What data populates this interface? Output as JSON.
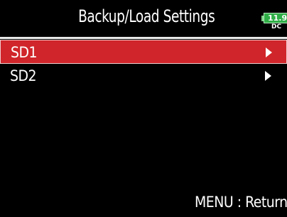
{
  "header": {
    "title": "Backup/Load Settings",
    "battery": {
      "voltage": "11.9",
      "power_source": "DC",
      "color": "#2fae47"
    }
  },
  "menu": {
    "selected_index": 0,
    "selected_color": "#d0252a",
    "items": [
      {
        "label": "SD1",
        "icon": "chevron-right-icon"
      },
      {
        "label": "SD2",
        "icon": "chevron-right-icon"
      }
    ]
  },
  "footer": {
    "hint": "MENU : Return"
  }
}
